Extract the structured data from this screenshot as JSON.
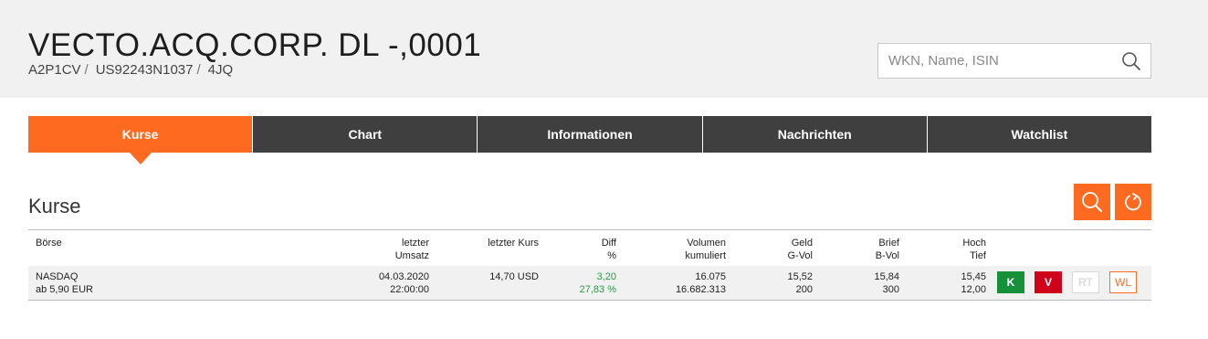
{
  "header": {
    "title": "VECTO.ACQ.CORP. DL -,0001",
    "wkn": "A2P1CV",
    "isin": "US92243N1037",
    "symbol": "4JQ",
    "separator": "/"
  },
  "search": {
    "placeholder": "WKN, Name, ISIN",
    "icon": "search-icon"
  },
  "tabs": [
    {
      "label": "Kurse",
      "active": true
    },
    {
      "label": "Chart",
      "active": false
    },
    {
      "label": "Informationen",
      "active": false
    },
    {
      "label": "Nachrichten",
      "active": false
    },
    {
      "label": "Watchlist",
      "active": false
    }
  ],
  "section": {
    "title": "Kurse",
    "tools": [
      "search-icon",
      "refresh-icon"
    ]
  },
  "table": {
    "headers": {
      "boerse": "Börse",
      "umsatz_1": "letzter",
      "umsatz_2": "Umsatz",
      "kurs": "letzter Kurs",
      "diff_1": "Diff",
      "diff_2": "%",
      "vol_1": "Volumen",
      "vol_2": "kumuliert",
      "geld_1": "Geld",
      "geld_2": "G-Vol",
      "brief_1": "Brief",
      "brief_2": "B-Vol",
      "hoch_1": "Hoch",
      "hoch_2": "Tief"
    },
    "rows": [
      {
        "exchange": "NASDAQ",
        "exchange_sub": "ab 5,90 EUR",
        "date": "04.03.2020",
        "time": "22:00:00",
        "last_price": "14,70 USD",
        "diff": "3,20",
        "diff_pct": "27,83 %",
        "volume": "16.075",
        "volume_cum": "16.682.313",
        "bid": "15,52",
        "bid_vol": "200",
        "ask": "15,84",
        "ask_vol": "300",
        "high": "15,45",
        "low": "12,00",
        "actions": {
          "buy": "K",
          "sell": "V",
          "realtime": "RT",
          "watchlist": "WL"
        }
      }
    ]
  },
  "colors": {
    "accent": "#ff6a21",
    "tab_dark": "#3f3f3f",
    "header_bg": "#f1f1f1",
    "positive": "#2a9b46",
    "buy": "#16913a",
    "sell": "#d0021b"
  }
}
